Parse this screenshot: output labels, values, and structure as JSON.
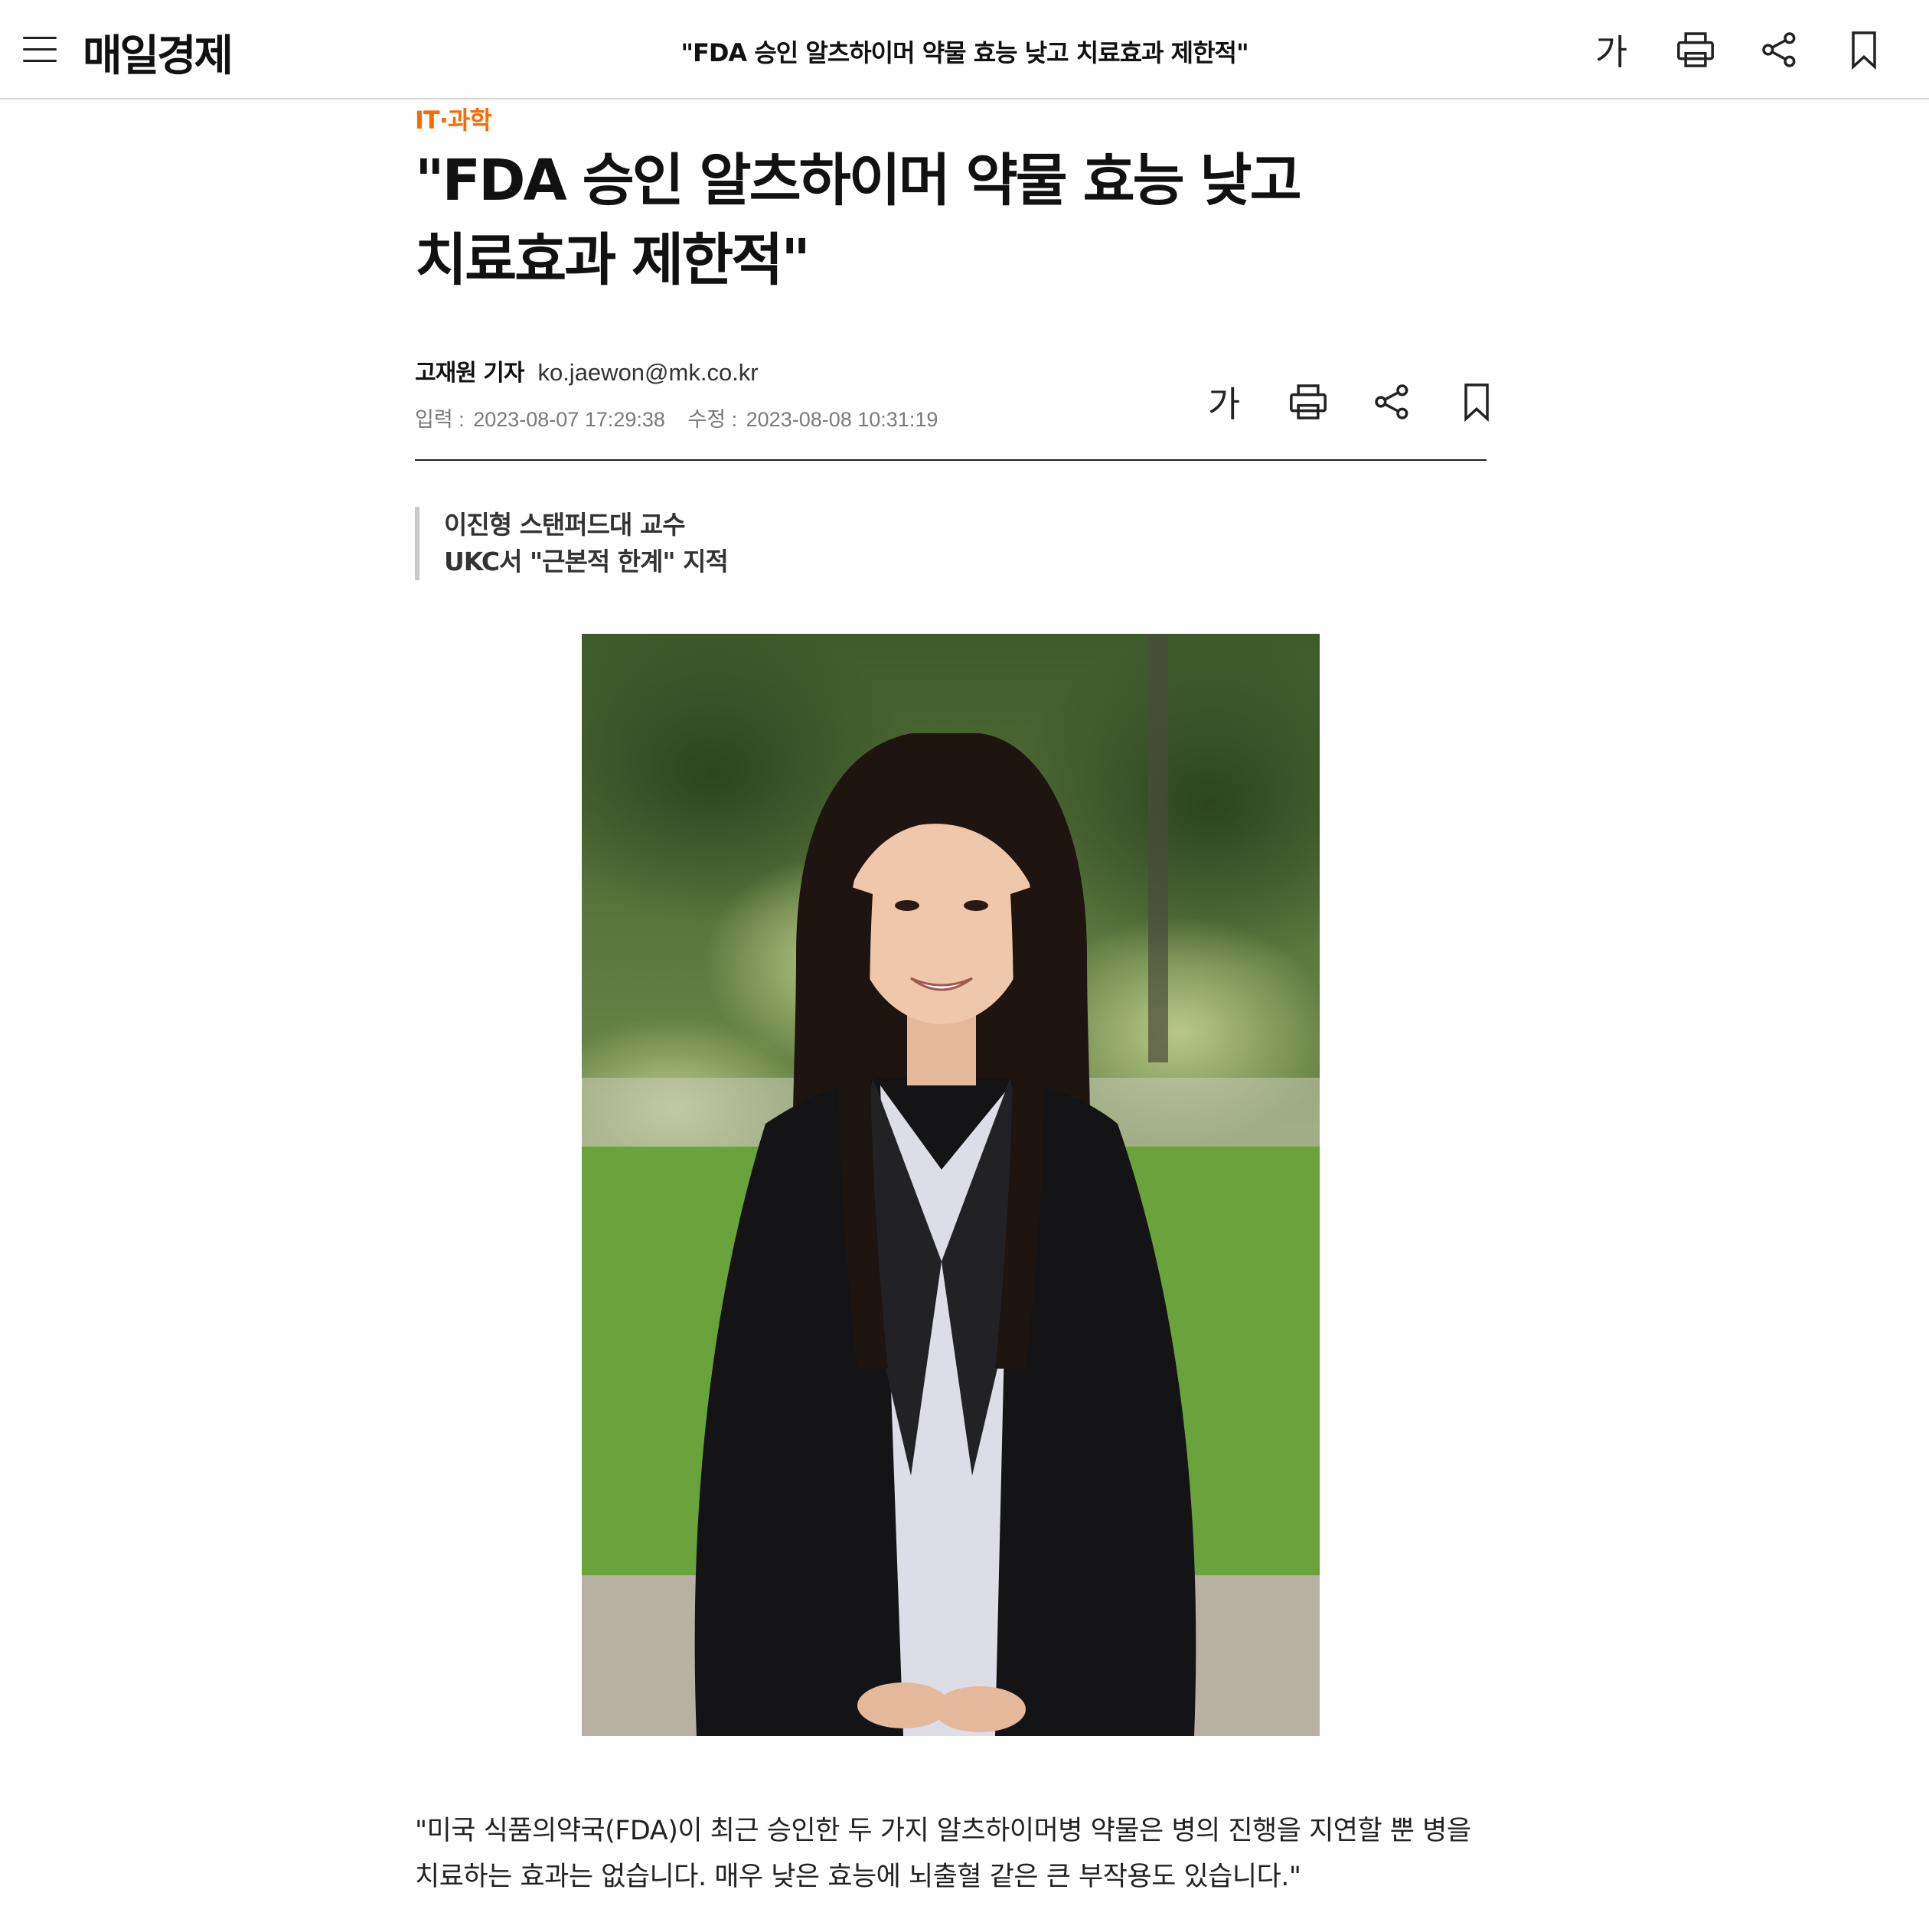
{
  "header": {
    "logo": "매일경제",
    "title": "\"FDA 승인 알츠하이머 약물 효능 낮고 치료효과 제한적\"",
    "menu_icon": "hamburger-menu-icon"
  },
  "tools": {
    "font_size_label": "가",
    "icons": [
      "font-size-icon",
      "print-icon",
      "share-icon",
      "bookmark-icon"
    ]
  },
  "article": {
    "category": "IT·과학",
    "headline_lines": [
      "\"FDA 승인 알츠하이머 약물 효능 낮고",
      "치료효과 제한적\""
    ],
    "reporter": "고재원 기자",
    "email": "ko.jaewon@mk.co.kr",
    "input_label": "입력 :",
    "input_time": "2023-08-07 17:29:38",
    "modified_label": "수정 :",
    "modified_time": "2023-08-08 10:31:19",
    "subheadlines": [
      "이진형 스탠퍼드대 교수",
      "UKC서 \"근본적 한계\" 지적"
    ],
    "body": [
      "\"미국 식품의약국(FDA)이 최근 승인한 두 가지 알츠하이머병 약물은 병의 진행을 지연할 뿐 병을",
      "치료하는 효과는 없습니다. 매우 낮은 효능에 뇌출혈 같은 큰 부작용도 있습니다.\""
    ]
  },
  "colors": {
    "category": "#ff6a00",
    "rule": "#222222",
    "header_border": "#d8d8d8"
  }
}
